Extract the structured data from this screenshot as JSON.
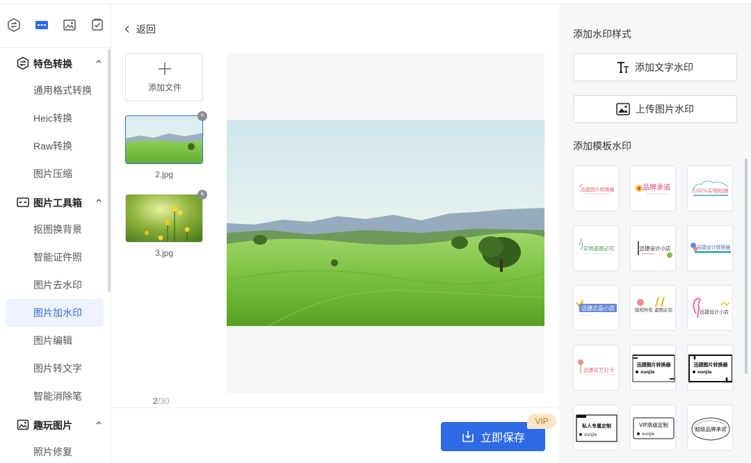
{
  "sidebar": {
    "top_icons": [
      "convert-icon",
      "toolbox-icon",
      "image-fun-icon",
      "checklist-icon"
    ],
    "groups": [
      {
        "label": "特色转换",
        "icon": "convert-icon",
        "items": [
          "通用格式转换",
          "Heic转换",
          "Raw转换",
          "图片压缩"
        ]
      },
      {
        "label": "图片工具箱",
        "icon": "toolbox-icon",
        "items": [
          "抠图换背景",
          "智能证件照",
          "图片去水印",
          "图片加水印",
          "图片编辑",
          "图片转文字",
          "智能消除笔"
        ]
      },
      {
        "label": "趣玩图片",
        "icon": "image-fun-icon",
        "items": [
          "照片修复"
        ]
      }
    ],
    "active_item": "图片加水印"
  },
  "main": {
    "back_label": "返回",
    "add_file_label": "添加文件",
    "files": [
      {
        "name": "2.jpg",
        "selected": true
      },
      {
        "name": "3.jpg",
        "selected": false
      }
    ],
    "counter": {
      "current": "2",
      "total": "/30"
    },
    "save_label": "立即保存",
    "vip_label": "VIP"
  },
  "right": {
    "style_title": "添加水印样式",
    "text_watermark_label": "添加文字水印",
    "image_watermark_label": "上传图片水印",
    "template_title": "添加模板水印",
    "templates": [
      {
        "text": "迅捷图片转换器"
      },
      {
        "text": "品牌承诺"
      },
      {
        "text": "100%实物拍摄"
      },
      {
        "text": "实物盗图必究"
      },
      {
        "text": "迅捷设计小店"
      },
      {
        "text": "迅捷设计转换器"
      },
      {
        "text": "迅捷正品小店"
      },
      {
        "text": "版权所有 盗图必究"
      },
      {
        "text": "迅捷设计小店"
      },
      {
        "text": "迅捷花艺打卡"
      },
      {
        "text": "迅捷图片转换器",
        "sub": "xunjie"
      },
      {
        "text": "迅捷图片转换器",
        "sub": "xunjie"
      },
      {
        "text": "私人专属定制",
        "sub": "xunjie"
      },
      {
        "text": "VIP高级定制",
        "sub": "xunjie"
      },
      {
        "text": "超级品牌承诺"
      }
    ]
  },
  "colors": {
    "accent": "#2f6ae5",
    "vip_bg": "#fde6c8",
    "vip_text": "#b7741a"
  }
}
